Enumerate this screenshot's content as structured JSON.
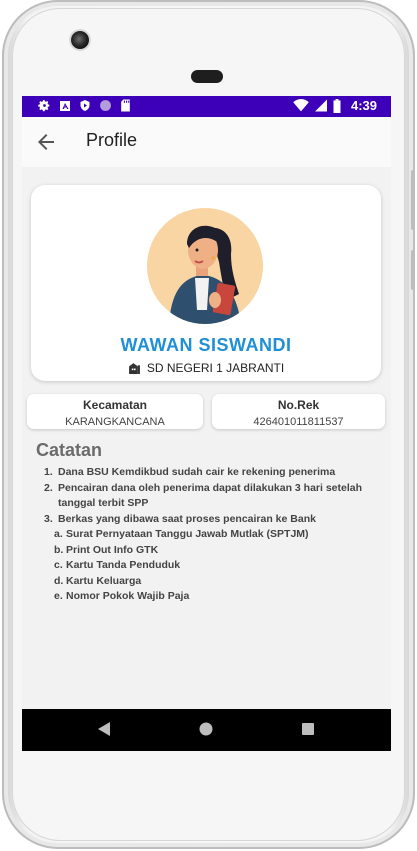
{
  "status_bar": {
    "time": "4:39",
    "left_icons": [
      "gear-icon",
      "a-icon",
      "shield-icon",
      "circle-icon",
      "sdcard-icon"
    ],
    "right_icons": [
      "wifi-icon",
      "signal-icon",
      "battery-icon"
    ],
    "color": "#3d00b8"
  },
  "app_bar": {
    "back_icon": "arrow-back-icon",
    "title": "Profile"
  },
  "profile": {
    "name": "WAWAN SISWANDI",
    "school": "SD NEGERI 1 JABRANTI",
    "school_icon": "school-building-icon",
    "name_color": "#1f8fd6"
  },
  "info": {
    "kecamatan_label": "Kecamatan",
    "kecamatan_value": "KARANGKANCANA",
    "norek_label": "No.Rek",
    "norek_value": "426401011811537"
  },
  "notes": {
    "title": "Catatan",
    "items": [
      {
        "num": "1.",
        "text": "Dana BSU Kemdikbud sudah cair ke rekening penerima"
      },
      {
        "num": "2.",
        "text": "Pencairan dana oleh penerima dapat dilakukan 3 hari setelah tanggal terbit SPP"
      },
      {
        "num": "3.",
        "text": "Berkas yang dibawa saat proses pencairan ke Bank"
      }
    ],
    "sub_items": [
      {
        "num": "a.",
        "text": "Surat Pernyataan Tanggu Jawab Mutlak (SPTJM)"
      },
      {
        "num": "b.",
        "text": "Print Out Info GTK"
      },
      {
        "num": "c.",
        "text": "Kartu Tanda Penduduk"
      },
      {
        "num": "d.",
        "text": "Kartu Keluarga"
      },
      {
        "num": "e.",
        "text": "Nomor Pokok Wajib Paja"
      }
    ]
  },
  "nav_bar": {
    "buttons": [
      "back-triangle-icon",
      "home-circle-icon",
      "recents-square-icon"
    ]
  }
}
